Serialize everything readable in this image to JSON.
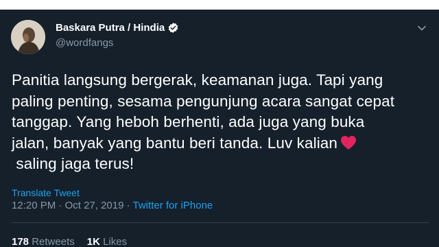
{
  "tweet": {
    "author": {
      "display_name": "Baskara Putra / Hindia",
      "handle": "@wordfangs",
      "avatar_icon": "user-avatar",
      "verified_icon": "verified-badge-icon"
    },
    "menu_icon": "chevron-down-icon",
    "text_lines": [
      "Panitia langsung bergerak, keamanan juga. Tapi yang",
      "paling penting, sesama pengunjung acara sangat cepat",
      "tanggap. Yang heboh berhenti, ada juga yang buka",
      "jalan, banyak yang bantu beri tanda. Luv kalian",
      " saling jaga terus!"
    ],
    "emoji_icon": "red-heart-icon",
    "translate_label": "Translate Tweet",
    "time": "12:20 PM",
    "separator": " · ",
    "date": "Oct 27, 2019",
    "source": "Twitter for iPhone",
    "stats": {
      "retweets_count": "178",
      "retweets_label": "Retweets",
      "likes_count": "1K",
      "likes_label": "Likes"
    }
  },
  "colors": {
    "background": "#15202b",
    "text": "#ffffff",
    "secondary": "#8899a6",
    "link": "#1da1f2",
    "heart": "#e0245e"
  }
}
